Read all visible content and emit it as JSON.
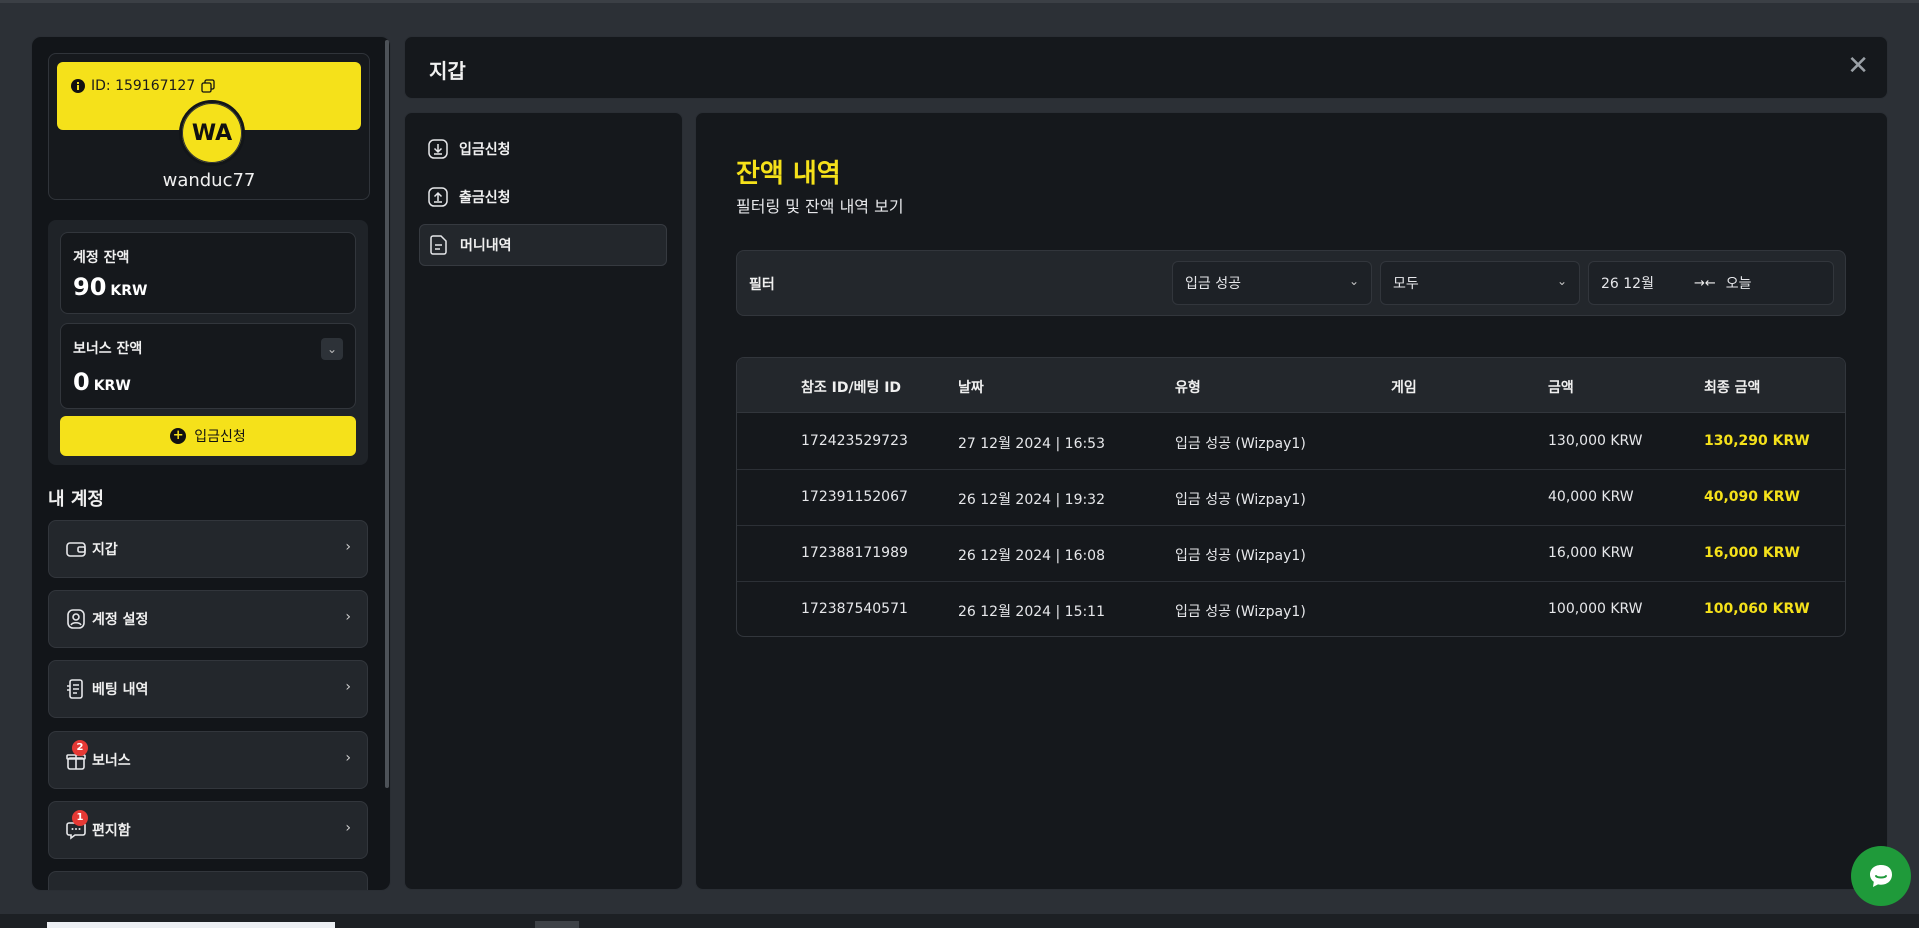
{
  "sidebar": {
    "profile": {
      "id_label": "ID: 159167127",
      "avatar_initials": "WA",
      "username": "wanduc77"
    },
    "balances": {
      "account": {
        "title": "계정 잔액",
        "value": "90",
        "unit": "KRW"
      },
      "bonus": {
        "title": "보너스 잔액",
        "value": "0",
        "unit": "KRW"
      },
      "deposit_button": "입금신청"
    },
    "my_account_title": "내 계정",
    "menu": [
      {
        "label": "지갑",
        "icon": "wallet-icon"
      },
      {
        "label": "계정 설정",
        "icon": "user-settings-icon"
      },
      {
        "label": "베팅 내역",
        "icon": "receipt-icon"
      },
      {
        "label": "보너스",
        "icon": "gift-icon",
        "badge": "2"
      },
      {
        "label": "편지함",
        "icon": "message-icon",
        "badge": "1"
      }
    ]
  },
  "header": {
    "title": "지갑"
  },
  "subnav": [
    {
      "label": "입금신청",
      "icon": "download-icon"
    },
    {
      "label": "출금신청",
      "icon": "upload-icon"
    },
    {
      "label": "머니내역",
      "icon": "document-icon",
      "active": true
    }
  ],
  "main": {
    "title": "잔액 내역",
    "subtitle": "필터링 및 잔액 내역 보기",
    "filter": {
      "label": "필터",
      "status_select": "입금 성공",
      "type_select": "모두",
      "date_from": "26 12월",
      "date_to": "오늘"
    },
    "table": {
      "headers": [
        "참조 ID/베팅 ID",
        "날짜",
        "유형",
        "게임",
        "금액",
        "최종 금액"
      ],
      "rows": [
        [
          "172423529723",
          "27 12월 2024 | 16:53",
          "입금 성공 (Wizpay1)",
          "",
          "130,000 KRW",
          "130,290 KRW"
        ],
        [
          "172391152067",
          "26 12월 2024 | 19:32",
          "입금 성공 (Wizpay1)",
          "",
          "40,000 KRW",
          "40,090 KRW"
        ],
        [
          "172388171989",
          "26 12월 2024 | 16:08",
          "입금 성공 (Wizpay1)",
          "",
          "16,000 KRW",
          "16,000 KRW"
        ],
        [
          "172387540571",
          "26 12월 2024 | 15:11",
          "입금 성공 (Wizpay1)",
          "",
          "100,000 KRW",
          "100,060 KRW"
        ]
      ]
    }
  },
  "colors": {
    "accent": "#f5e11a",
    "bg": "#15181c",
    "chat": "#1f9a3a",
    "badge": "#e53935"
  }
}
